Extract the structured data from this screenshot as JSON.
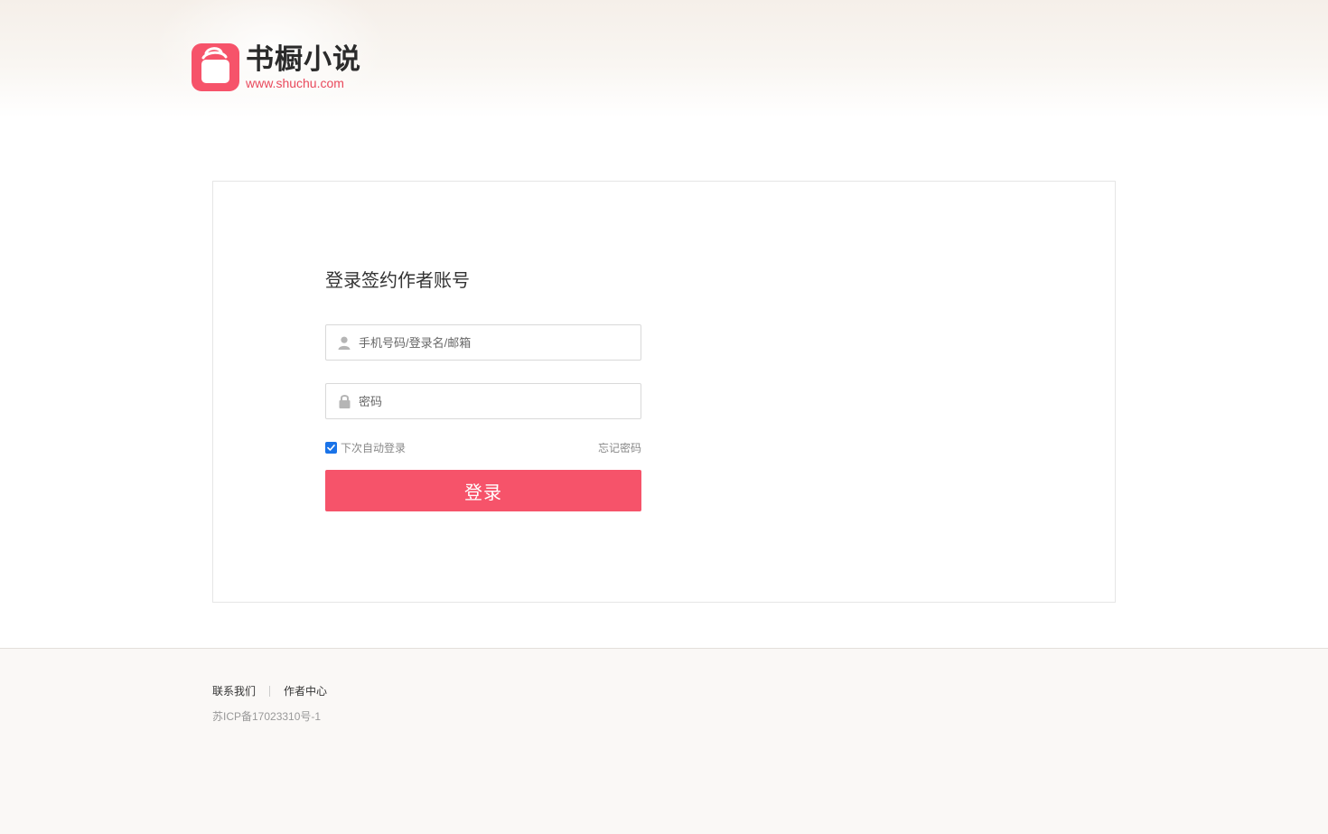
{
  "header": {
    "logo_name": "书橱小说",
    "logo_url": "www.shuchu.com",
    "brand_color": "#f6536a"
  },
  "login": {
    "title": "登录签约作者账号",
    "username_placeholder": "手机号码/登录名/邮箱",
    "username_icon": "user-icon",
    "password_placeholder": "密码",
    "password_icon": "lock-icon",
    "remember_label": "下次自动登录",
    "remember_checked": true,
    "forgot_label": "忘记密码",
    "submit_label": "登录"
  },
  "footer": {
    "links": [
      "联系我们",
      "作者中心"
    ],
    "icp": "苏ICP备17023310号-1"
  }
}
